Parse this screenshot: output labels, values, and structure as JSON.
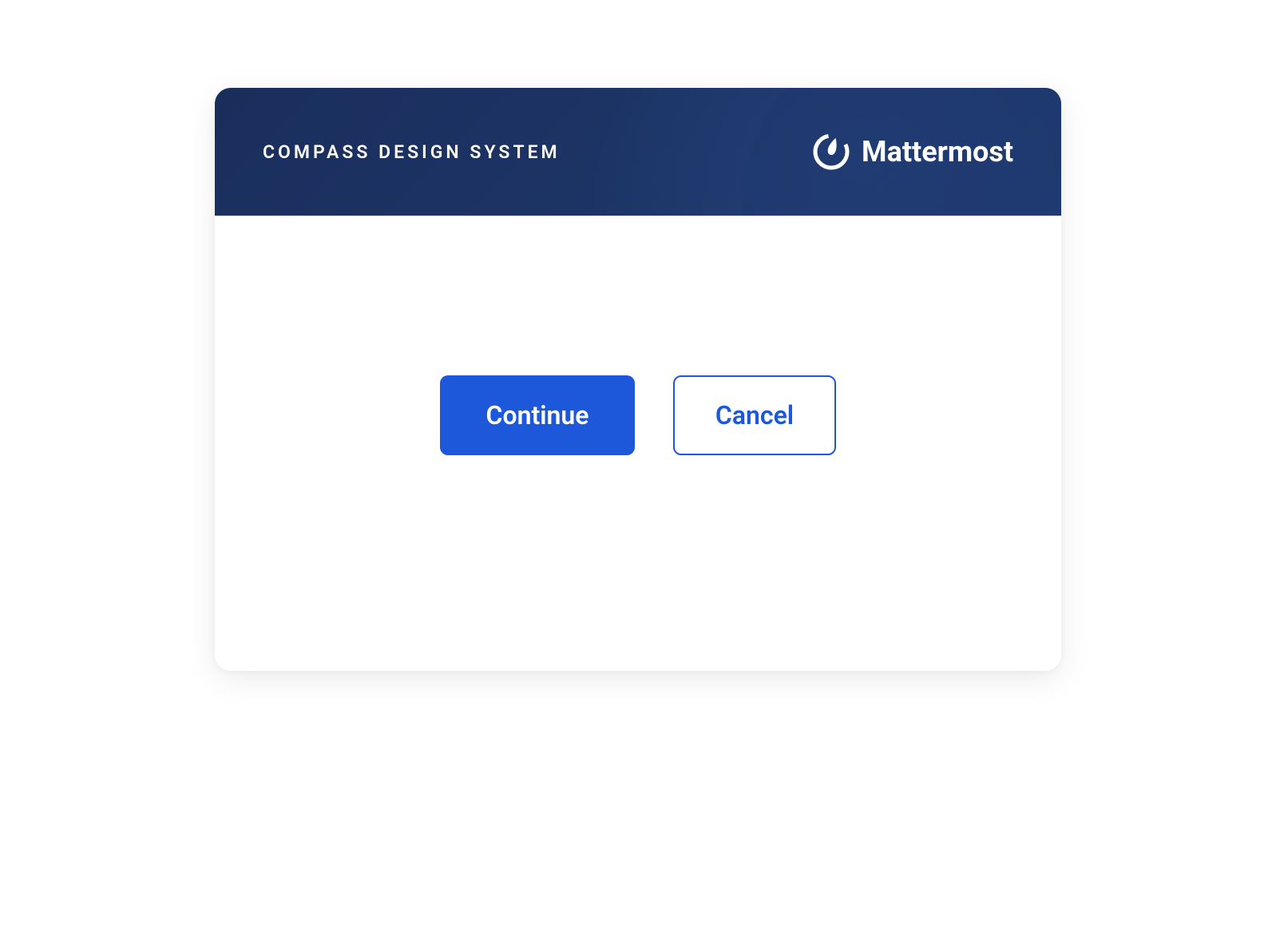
{
  "header": {
    "title": "COMPASS DESIGN SYSTEM",
    "brand_name": "Mattermost"
  },
  "buttons": {
    "primary_label": "Continue",
    "secondary_label": "Cancel"
  },
  "colors": {
    "primary_blue": "#1c58d9",
    "header_bg": "#1e3a6e"
  }
}
